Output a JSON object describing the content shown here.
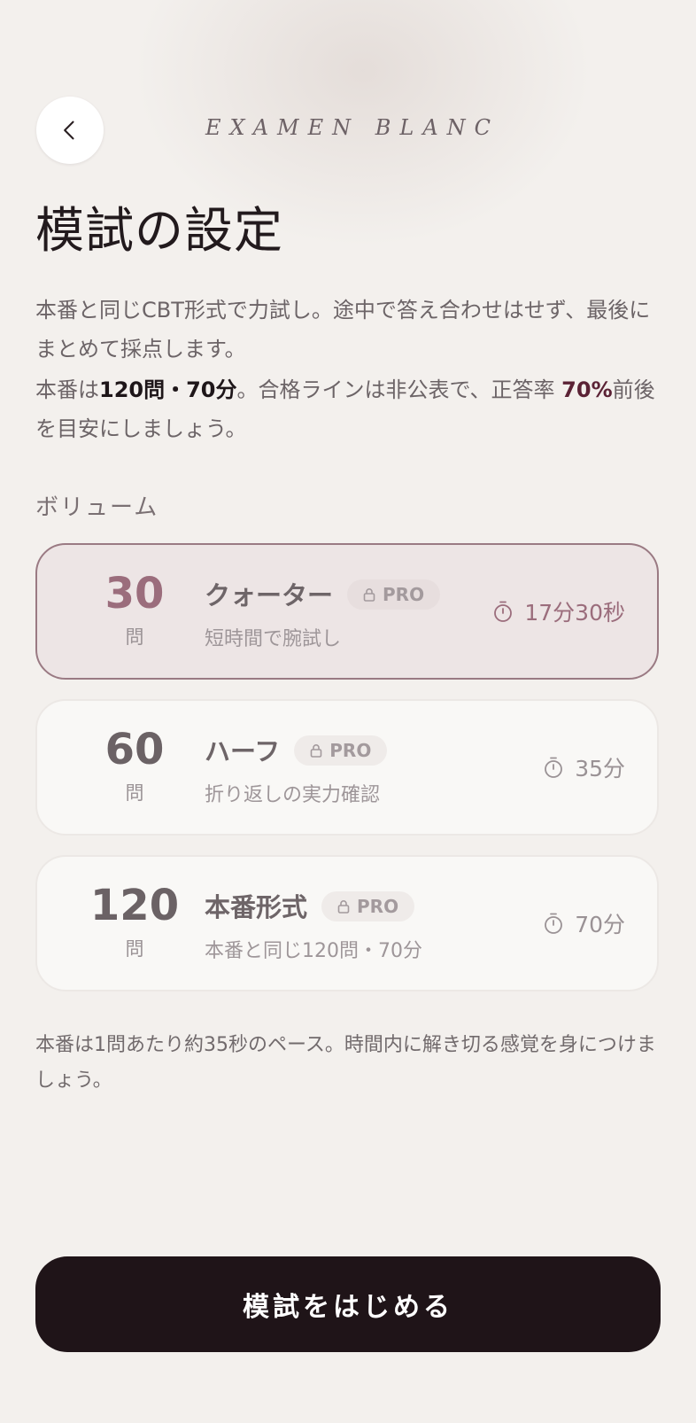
{
  "header": {
    "brand": "EXAMEN BLANC"
  },
  "page": {
    "title": "模試の設定",
    "intro_line1": "本番と同じCBT形式で力試し。途中で答え合わせはせず、最後にまとめて採点します。",
    "intro_prefix": "本番は",
    "intro_strong": "120問・70分",
    "intro_middle": "。合格ラインは非公表で、正答率 ",
    "intro_accent": "70%",
    "intro_suffix": "前後を目安にしましょう。"
  },
  "volume": {
    "label": "ボリューム",
    "options": [
      {
        "count": "30",
        "unit": "問",
        "name": "クォーター",
        "badge": "PRO",
        "subtitle": "短時間で腕試し",
        "time": "17分30秒",
        "selected": true
      },
      {
        "count": "60",
        "unit": "問",
        "name": "ハーフ",
        "badge": "PRO",
        "subtitle": "折り返しの実力確認",
        "time": "35分",
        "selected": false
      },
      {
        "count": "120",
        "unit": "問",
        "name": "本番形式",
        "badge": "PRO",
        "subtitle": "本番と同じ120問・70分",
        "time": "70分",
        "selected": false
      }
    ]
  },
  "footnote": "本番は1問あたり約35秒のペース。時間内に解き切る感覚を身につけましょう。",
  "actions": {
    "start_label": "模試をはじめる"
  },
  "colors": {
    "background": "#f3f0ed",
    "accent": "#9b6d7c",
    "accent_strong": "#5b2235",
    "button": "#1f1418"
  },
  "icons": {
    "back": "chevron-left-icon",
    "lock": "lock-icon",
    "timer": "stopwatch-icon"
  }
}
